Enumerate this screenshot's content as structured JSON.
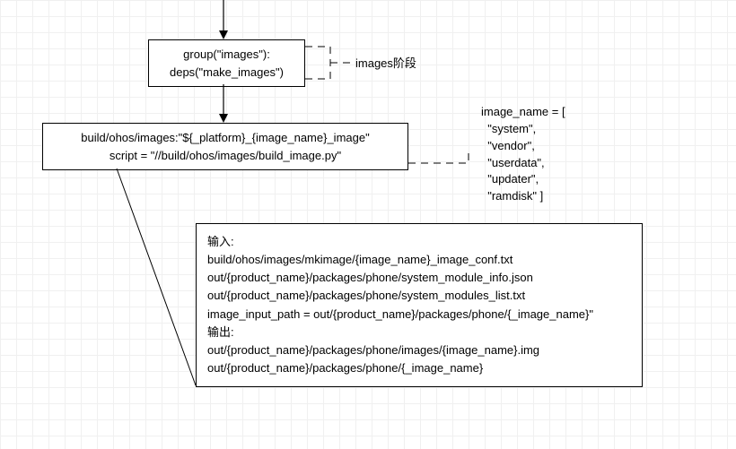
{
  "box1": {
    "line1": "group(\"images\"):",
    "line2": "deps(\"make_images\")"
  },
  "box2": {
    "line1": "build/ohos/images:\"${_platform}_{image_name}_image\"",
    "line2": "script = \"//build/ohos/images/build_image.py\""
  },
  "stage_label": "images阶段",
  "image_name_block": "image_name = [\n  \"system\",\n  \"vendor\",\n  \"userdata\",\n  \"updater\",\n  \"ramdisk\" ]",
  "io_box": {
    "line1": "输入:",
    "line2": "build/ohos/images/mkimage/{image_name}_image_conf.txt",
    "line3": "out/{product_name}/packages/phone/system_module_info.json",
    "line4": "out/{product_name}/packages/phone/system_modules_list.txt",
    "line5": "image_input_path = out/{product_name}/packages/phone/{_image_name}\"",
    "line6": "输出:",
    "line7": "out/{product_name}/packages/phone/images/{image_name}.img",
    "line8": "out/{product_name}/packages/phone/{_image_name}"
  }
}
